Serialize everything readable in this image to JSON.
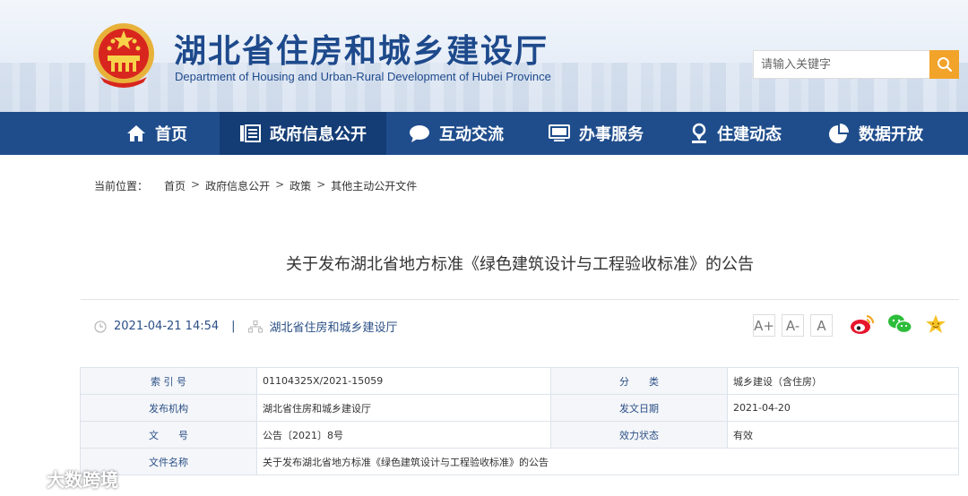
{
  "header": {
    "title": "湖北省住房和城乡建设厅",
    "subtitle": "Department of Housing and Urban-Rural Development of Hubei Province",
    "search_placeholder": "请输入关键字"
  },
  "nav": [
    {
      "label": "首页",
      "icon": "home-icon"
    },
    {
      "label": "政府信息公开",
      "icon": "document-list-icon",
      "active": true
    },
    {
      "label": "互动交流",
      "icon": "chat-bubble-icon"
    },
    {
      "label": "办事服务",
      "icon": "monitor-icon"
    },
    {
      "label": "住建动态",
      "icon": "location-pin-icon"
    },
    {
      "label": "数据开放",
      "icon": "pie-chart-icon"
    }
  ],
  "breadcrumb": {
    "prefix": "当前位置：",
    "items": [
      "首页",
      "政府信息公开",
      "政策",
      "其他主动公开文件"
    ],
    "separator": ">"
  },
  "article": {
    "title": "关于发布湖北省地方标准《绿色建筑设计与工程验收标准》的公告",
    "datetime": "2021-04-21 14:54",
    "source": "湖北省住房和城乡建设厅"
  },
  "font_buttons": [
    "A+",
    "A-",
    "A"
  ],
  "info_table": [
    {
      "k1": "索 引 号",
      "v1": "01104325X/2021-15059",
      "k2": "分　　类",
      "v2": "城乡建设（含住房）"
    },
    {
      "k1": "发布机构",
      "v1": "湖北省住房和城乡建设厅",
      "k2": "发文日期",
      "v2": "2021-04-20"
    },
    {
      "k1": "文　　号",
      "v1": "公告〔2021〕8号",
      "k2": "效力状态",
      "v2": "有效"
    },
    {
      "k1": "文件名称",
      "v1": "关于发布湖北省地方标准《绿色建筑设计与工程验收标准》的公告"
    }
  ],
  "watermark": "大数跨境",
  "colors": {
    "nav_bg": "#1f4d8c",
    "accent": "#f2a32a",
    "link": "#2b4f86"
  }
}
